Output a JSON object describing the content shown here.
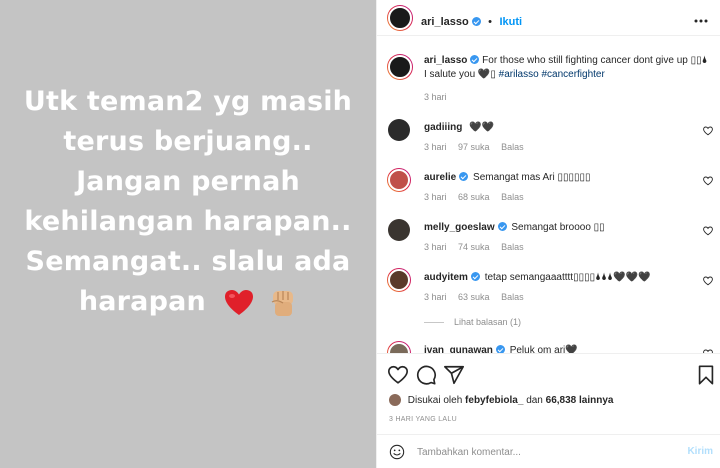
{
  "media": {
    "lines": [
      "Utk teman2 yg masih",
      "terus berjuang..",
      "Jangan pernah",
      "kehilangan harapan..",
      "Semangat.. slalu ada",
      "harapan"
    ]
  },
  "header": {
    "username": "ari_lasso",
    "separator": "•",
    "follow_label": "Ikuti",
    "more_icon": "more-horizontal-icon"
  },
  "caption": {
    "username": "ari_lasso",
    "text_line1": "For those who still fighting cancer dont give up ▯▯🌢",
    "text_line2": "I salute you 🖤▯ ",
    "hashtags": "#arilasso #cancerfighter",
    "time": "3 hari"
  },
  "comments": [
    {
      "username": "gadiiing",
      "verified": false,
      "text": "🖤🖤",
      "time": "3 hari",
      "likes": "97 suka",
      "reply": "Balas"
    },
    {
      "username": "aurelie",
      "verified": true,
      "text": "Semangat mas Ari ▯▯▯▯▯▯",
      "time": "3 hari",
      "likes": "68 suka",
      "reply": "Balas"
    },
    {
      "username": "melly_goeslaw",
      "verified": true,
      "text": "Semangat broooo ▯▯",
      "time": "3 hari",
      "likes": "74 suka",
      "reply": "Balas"
    },
    {
      "username": "audyitem",
      "verified": true,
      "text": "tetap semangaaatttt▯▯▯▯🌢🌢🌢🖤🖤🖤",
      "time": "3 hari",
      "likes": "63 suka",
      "reply": "Balas"
    },
    {
      "username": "ivan_gunawan",
      "verified": true,
      "text": "Peluk om ari🖤"
    }
  ],
  "view_replies": "Lihat balasan (1)",
  "likes_line": {
    "prefix": "Disukai oleh",
    "user": "febyfebiola_",
    "mid": "dan",
    "count": "66,838 lainnya"
  },
  "timestamp": "3 HARI YANG LALU",
  "add_comment": {
    "placeholder": "Tambahkan komentar...",
    "post_label": "Kirim"
  },
  "colors": {
    "accent": "#0095f6",
    "verified": "#3897f0",
    "media_bg": "#c4c4c4",
    "heart": "#e0202a"
  }
}
